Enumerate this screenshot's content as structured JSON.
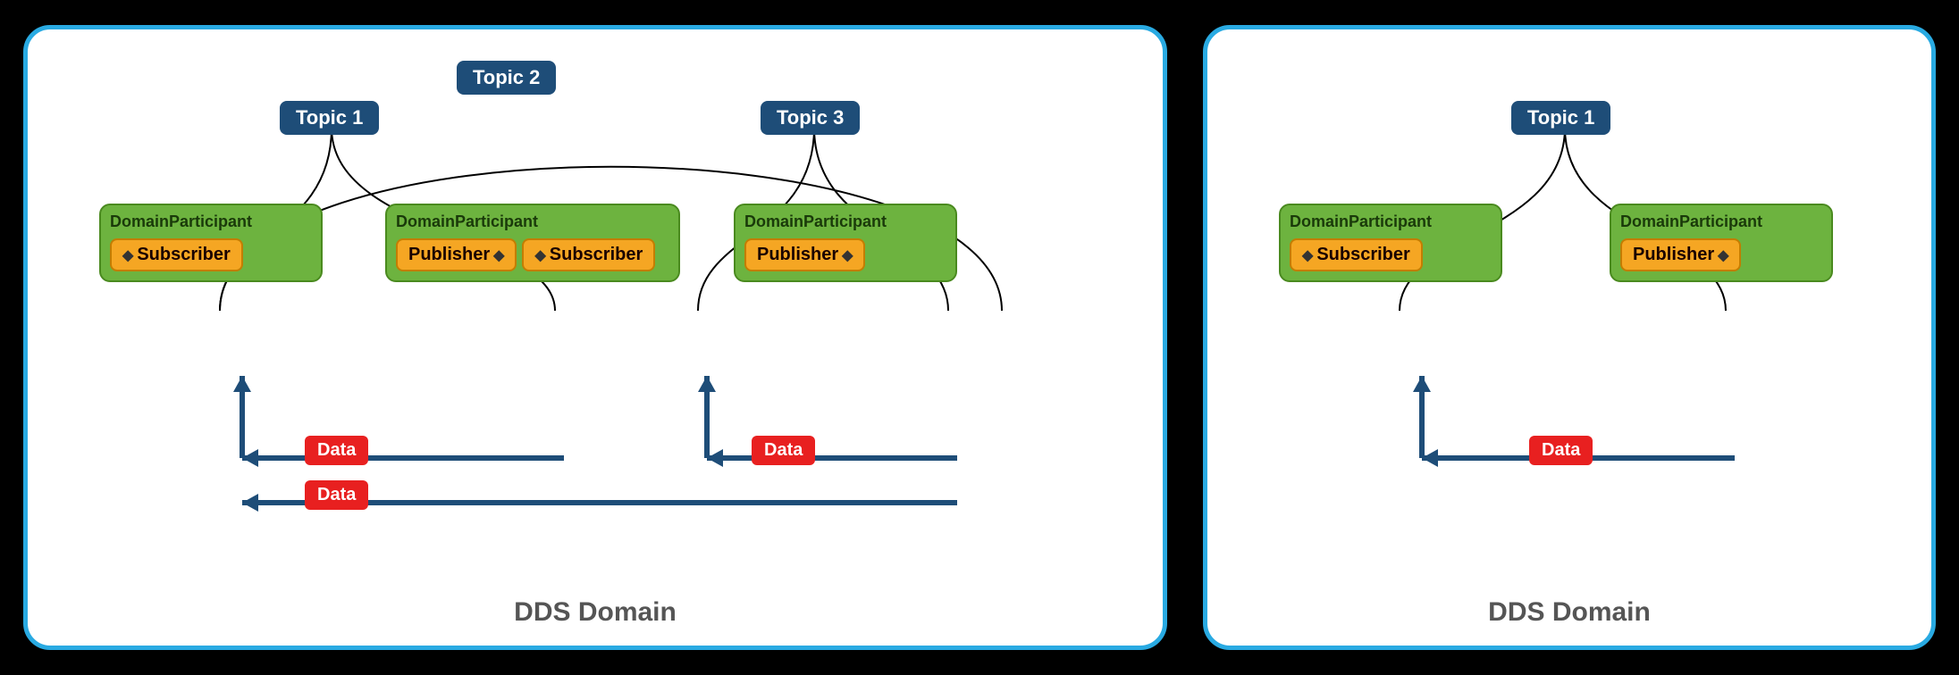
{
  "leftDomain": {
    "label": "DDS Domain",
    "topic1": "Topic 1",
    "topic2": "Topic 2",
    "topic3": "Topic 3",
    "dp1": {
      "label": "DomainParticipant",
      "subscriber": "Subscriber"
    },
    "dp2": {
      "label": "DomainParticipant",
      "publisher": "Publisher",
      "subscriber": "Subscriber"
    },
    "dp3": {
      "label": "DomainParticipant",
      "publisher": "Publisher"
    },
    "data1": "Data",
    "data2": "Data",
    "data3": "Data"
  },
  "rightDomain": {
    "label": "DDS Domain",
    "topic1": "Topic 1",
    "dp1": {
      "label": "DomainParticipant",
      "subscriber": "Subscriber"
    },
    "dp2": {
      "label": "DomainParticipant",
      "publisher": "Publisher"
    },
    "data1": "Data"
  }
}
